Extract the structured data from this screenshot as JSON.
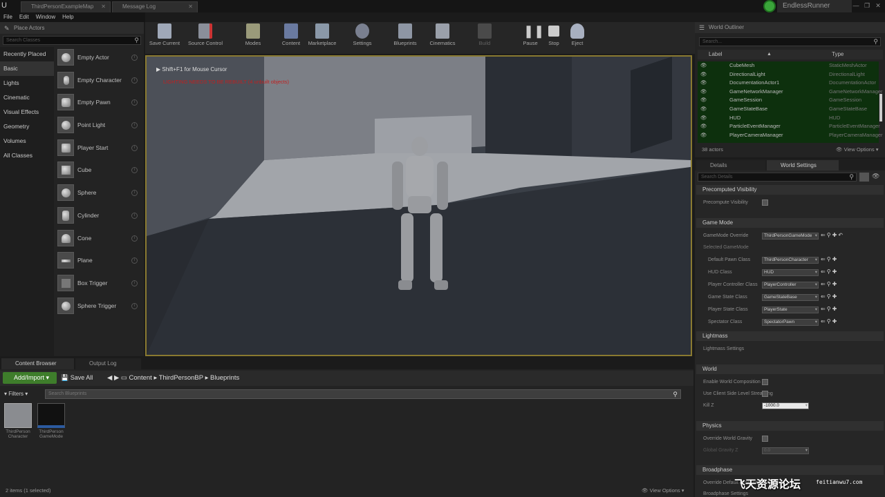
{
  "window": {
    "tabs": [
      "ThirdPersonExampleMap",
      "Message Log"
    ],
    "project_name": "EndlessRunner",
    "controls": [
      "—",
      "❐",
      "✕"
    ]
  },
  "menu": [
    "File",
    "Edit",
    "Window",
    "Help"
  ],
  "place_actors": {
    "title": "Place Actors",
    "search_placeholder": "Search Classes",
    "categories": [
      "Recently Placed",
      "Basic",
      "Lights",
      "Cinematic",
      "Visual Effects",
      "Geometry",
      "Volumes",
      "All Classes"
    ],
    "selected_category": "Basic",
    "actors": [
      "Empty Actor",
      "Empty Character",
      "Empty Pawn",
      "Point Light",
      "Player Start",
      "Cube",
      "Sphere",
      "Cylinder",
      "Cone",
      "Plane",
      "Box Trigger",
      "Sphere Trigger"
    ]
  },
  "toolbar": [
    "Save Current",
    "Source Control",
    "Modes",
    "Content",
    "Marketplace",
    "Settings",
    "Blueprints",
    "Cinematics",
    "Build",
    "Pause",
    "Stop",
    "Eject"
  ],
  "viewport": {
    "hint": "Shift+F1 for Mouse Cursor",
    "warning": "LIGHTING NEEDS TO BE REBUILT (4 unbuilt objects)"
  },
  "outliner": {
    "title": "World Outliner",
    "search_placeholder": "Search...",
    "col_label": "Label",
    "col_type": "Type",
    "rows": [
      {
        "label": "CubeMesh",
        "type": "StaticMeshActor"
      },
      {
        "label": "DirectionalLight",
        "type": "DirectionalLight"
      },
      {
        "label": "DocumentationActor1",
        "type": "DocumentationActor"
      },
      {
        "label": "GameNetworkManager",
        "type": "GameNetworkManager"
      },
      {
        "label": "GameSession",
        "type": "GameSession"
      },
      {
        "label": "GameStateBase",
        "type": "GameStateBase"
      },
      {
        "label": "HUD",
        "type": "HUD"
      },
      {
        "label": "ParticleEventManager",
        "type": "ParticleEventManager"
      },
      {
        "label": "PlayerCameraManager",
        "type": "PlayerCameraManager"
      }
    ],
    "count": "38 actors",
    "view_options": "View Options"
  },
  "details": {
    "tab_details": "Details",
    "tab_world_settings": "World Settings",
    "search_placeholder": "Search Details",
    "sections": {
      "precomputed": "Precomputed Visibility",
      "game_mode": "Game Mode",
      "lightmass": "Lightmass",
      "world": "World",
      "physics": "Physics",
      "broadphase": "Broadphase"
    },
    "props": {
      "precomputed_visibility": "Precompute Visibility",
      "gamemode_override": "GameMode Override",
      "selected_gamemode": "Selected GameMode",
      "default_pawn": "Default Pawn Class",
      "hud_class": "HUD Class",
      "player_controller": "Player Controller Class",
      "game_state": "Game State Class",
      "player_state": "Player State Class",
      "spectator": "Spectator Class",
      "lightmass_settings": "Lightmass Settings",
      "enable_world_comp": "Enable World Composition",
      "client_side_level": "Use Client Side Level Streaming",
      "kill_z": "Kill Z",
      "override_gravity": "Override World Gravity",
      "global_gravity": "Global Gravity Z",
      "override_broadphase": "Override Default Broadphase Settings",
      "broadphase_settings": "Broadphase Settings"
    },
    "values": {
      "gamemode_override": "ThirdPersonGameMode",
      "default_pawn": "ThirdPersonCharacter",
      "hud_class": "HUD",
      "player_controller": "PlayerController",
      "game_state": "GameStateBase",
      "player_state": "PlayerState",
      "spectator": "SpectatorPawn",
      "kill_z": "-1000.0",
      "global_gravity": "0.0"
    }
  },
  "content_browser": {
    "tab_content": "Content Browser",
    "tab_output": "Output Log",
    "add_import": "Add/Import",
    "save_all": "Save All",
    "breadcrumb": [
      "Content",
      "ThirdPersonBP",
      "Blueprints"
    ],
    "filters": "Filters",
    "search_placeholder": "Search Blueprints",
    "assets": [
      {
        "label": "ThirdPerson Character"
      },
      {
        "label": "ThirdPerson GameMode"
      }
    ],
    "status": "2 items (1 selected)",
    "view_options": "View Options"
  },
  "watermark": {
    "text": "飞天资源论坛",
    "url": "feitianwu7.com"
  }
}
